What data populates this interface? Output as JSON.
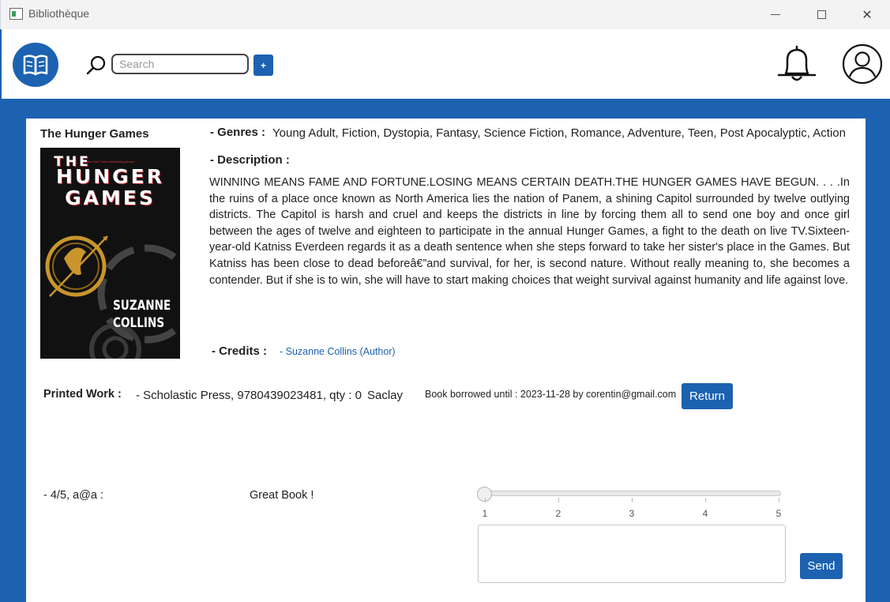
{
  "window": {
    "title": "Bibliothèque",
    "minimize_icon": "minimize-icon",
    "maximize_icon": "maximize-icon",
    "close_icon": "close-icon",
    "close_glyph": "✕"
  },
  "header": {
    "logo_icon": "book-icon",
    "search": {
      "placeholder": "Search",
      "value": ""
    },
    "add_button_label": "+",
    "notification_icon": "bell-icon",
    "profile_icon": "user-icon"
  },
  "colors": {
    "accent": "#1c62b0",
    "link": "#1c62b0",
    "panel_background": "#ffffff",
    "titlebar": "#f3f3f3"
  },
  "book": {
    "title": "The Hunger Games",
    "cover": {
      "line1": "THE",
      "line2": "HUNGER",
      "line3": "GAMES",
      "tagline": "New York Times Bestselling Author",
      "author_line1": "SUZANNE",
      "author_line2": "COLLINS"
    },
    "genres_label": "- Genres :",
    "genres": "Young Adult, Fiction, Dystopia, Fantasy, Science Fiction, Romance, Adventure, Teen, Post Apocalyptic, Action",
    "description_label": "- Description :",
    "description": "WINNING MEANS FAME AND FORTUNE.LOSING MEANS CERTAIN DEATH.THE HUNGER GAMES HAVE BEGUN. . . .In the ruins of a place once known as North America lies the nation of Panem, a shining Capitol surrounded by twelve outlying districts. The Capitol is harsh and cruel and keeps the districts in line by forcing them all to send one boy and once girl between the ages of twelve and eighteen to participate in the annual Hunger Games, a fight to the death on live TV.Sixteen-year-old Katniss Everdeen regards it as a death sentence when she steps forward to take her sister's place in the Games. But Katniss has been close to dead beforeâ€”and survival, for her, is second nature. Without really meaning to, she becomes a contender. But if she is to win, she will have to start making choices that weight survival against humanity and life against love.",
    "credits_label": "- Credits :",
    "credits": "- Suzanne Collins (Author)"
  },
  "printed_work": {
    "label": "Printed Work :",
    "edition": "- Scholastic Press, 9780439023481, qty : 0",
    "location": "Saclay",
    "borrow_info": "Book borrowed until : 2023-11-28 by corentin@gmail.com",
    "return_button_label": "Return"
  },
  "reviews": [
    {
      "author": "- 4/5, a@a :",
      "text": "Great Book !"
    }
  ],
  "new_review": {
    "rating_value": 1,
    "rating_min": 1,
    "rating_max": 5,
    "ticks": [
      "1",
      "2",
      "3",
      "4",
      "5"
    ],
    "comment": "",
    "send_button_label": "Send"
  }
}
